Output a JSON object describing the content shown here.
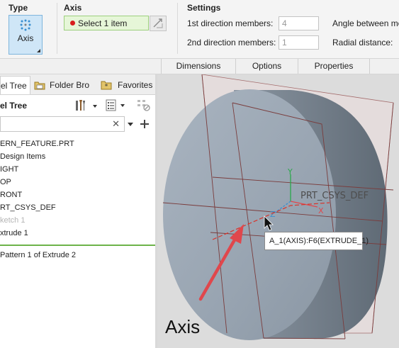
{
  "dashboard": {
    "type_title": "Type",
    "type_button_label": "Axis",
    "axis_title": "Axis",
    "axis_collector": "Select 1 item",
    "settings_title": "Settings",
    "first_dir_label": "1st direction members:",
    "first_dir_value": "4",
    "second_dir_label": "2nd direction members:",
    "second_dir_value": "1",
    "angle_label": "Angle between me",
    "radial_label": "Radial distance:"
  },
  "tabs": [
    "Dimensions",
    "Options",
    "Properties"
  ],
  "navigator": {
    "tabs": [
      "el Tree",
      "Folder Bro",
      "Favorites"
    ],
    "tree_title": "el Tree",
    "items": [
      {
        "label": "ERN_FEATURE.PRT",
        "dim": false
      },
      {
        "label": "Design Items",
        "dim": false
      },
      {
        "label": "IGHT",
        "dim": false
      },
      {
        "label": "OP",
        "dim": false
      },
      {
        "label": "RONT",
        "dim": false
      },
      {
        "label": "RT_CSYS_DEF",
        "dim": false
      },
      {
        "label": "ketch 1",
        "dim": true
      },
      {
        "label": "xtrude 1",
        "dim": false
      }
    ],
    "pattern_item": "Pattern 1 of Extrude 2"
  },
  "graphics": {
    "csys_label": "PRT_CSYS_DEF",
    "tooltip": "A_1(AXIS):F6(EXTRUDE_1)",
    "annotation": "Axis"
  },
  "colors": {
    "accent": "#7fb5dc",
    "collector_bg": "#e6f6d8",
    "arrow": "#e0474c",
    "model": "#9aa6b3"
  }
}
